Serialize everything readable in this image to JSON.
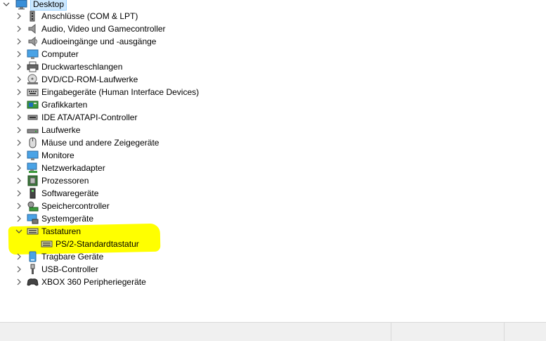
{
  "root": {
    "label": "Desktop",
    "icon": "desktop-icon"
  },
  "categories": [
    {
      "label": "Anschlüsse (COM & LPT)",
      "icon": "port-icon"
    },
    {
      "label": "Audio, Video und Gamecontroller",
      "icon": "speaker-icon"
    },
    {
      "label": "Audioeingänge und -ausgänge",
      "icon": "audio-io-icon"
    },
    {
      "label": "Computer",
      "icon": "monitor-icon"
    },
    {
      "label": "Druckwarteschlangen",
      "icon": "printer-icon"
    },
    {
      "label": "DVD/CD-ROM-Laufwerke",
      "icon": "disc-drive-icon"
    },
    {
      "label": "Eingabegeräte (Human Interface Devices)",
      "icon": "hid-icon"
    },
    {
      "label": "Grafikkarten",
      "icon": "graphics-card-icon"
    },
    {
      "label": "IDE ATA/ATAPI-Controller",
      "icon": "ide-controller-icon"
    },
    {
      "label": "Laufwerke",
      "icon": "drive-icon"
    },
    {
      "label": "Mäuse und andere Zeigegeräte",
      "icon": "mouse-icon"
    },
    {
      "label": "Monitore",
      "icon": "monitor-icon"
    },
    {
      "label": "Netzwerkadapter",
      "icon": "network-adapter-icon"
    },
    {
      "label": "Prozessoren",
      "icon": "processor-icon"
    },
    {
      "label": "Softwaregeräte",
      "icon": "software-device-icon"
    },
    {
      "label": "Speichercontroller",
      "icon": "storage-controller-icon"
    },
    {
      "label": "Systemgeräte",
      "icon": "system-device-icon"
    },
    {
      "label": "Tastaturen",
      "icon": "keyboard-icon",
      "expanded": true,
      "children": [
        {
          "label": "PS/2-Standardtastatur",
          "icon": "keyboard-icon"
        }
      ]
    },
    {
      "label": "Tragbare Geräte",
      "icon": "portable-device-icon"
    },
    {
      "label": "USB-Controller",
      "icon": "usb-icon"
    },
    {
      "label": "XBOX 360 Peripheriegeräte",
      "icon": "gamepad-icon"
    }
  ],
  "colors": {
    "highlight": "#ffff00",
    "selection": "#cce8ff"
  }
}
